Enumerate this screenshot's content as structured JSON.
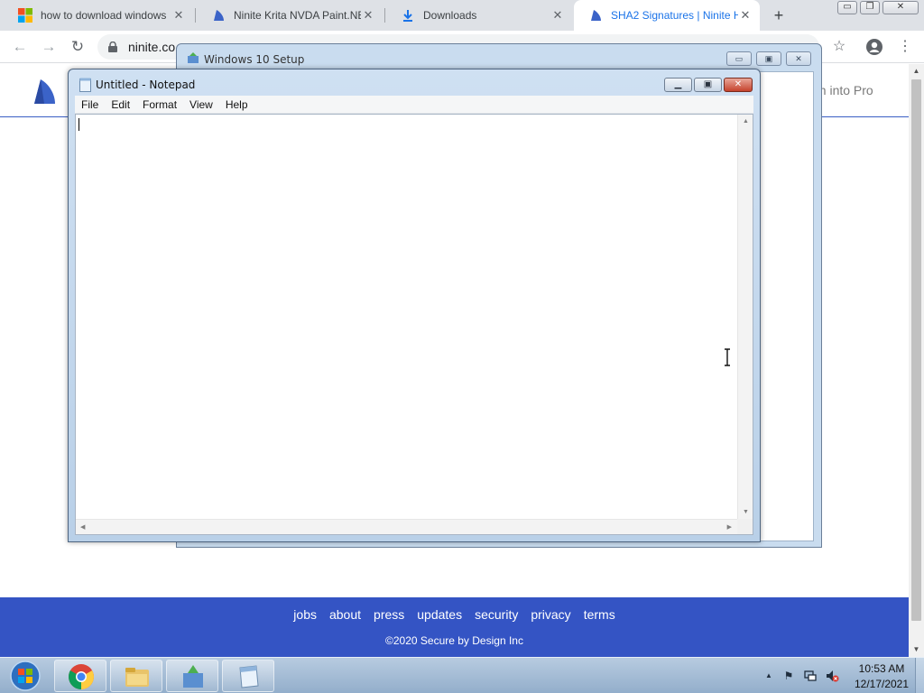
{
  "browser": {
    "tabs": [
      {
        "title": "how to download windows",
        "active": false
      },
      {
        "title": "Ninite Krita NVDA Paint.NET",
        "active": false
      },
      {
        "title": "Downloads",
        "active": false
      },
      {
        "title": "SHA2 Signatures | Ninite H",
        "active": true
      }
    ],
    "close_glyph": "✕",
    "new_tab_glyph": "+",
    "url": "ninite.co",
    "window_controls": {
      "minimize": "▭",
      "restore": "❐",
      "close": "✕"
    }
  },
  "page": {
    "login_text": "gn into Pro",
    "footer_links": [
      "jobs",
      "about",
      "press",
      "updates",
      "security",
      "privacy",
      "terms"
    ],
    "copyright": "©2020 Secure by Design Inc"
  },
  "setup_window": {
    "title": "Windows 10 Setup",
    "controls": {
      "minimize": "▭",
      "maximize": "▣",
      "close": "✕"
    }
  },
  "notepad": {
    "title": "Untitled - Notepad",
    "menu": [
      "File",
      "Edit",
      "Format",
      "View",
      "Help"
    ],
    "content": "",
    "controls": {
      "minimize": "▁",
      "maximize": "▣",
      "close": "✕"
    }
  },
  "taskbar": {
    "apps": [
      "chrome",
      "file-explorer",
      "windows-setup",
      "notepad"
    ],
    "clock_time": "10:53 AM",
    "clock_date": "12/17/2021",
    "tray_chevron": "▲"
  },
  "colors": {
    "accent": "#1a73e8",
    "footer_bg": "#3454c4",
    "notepad_close": "#c5422c"
  }
}
